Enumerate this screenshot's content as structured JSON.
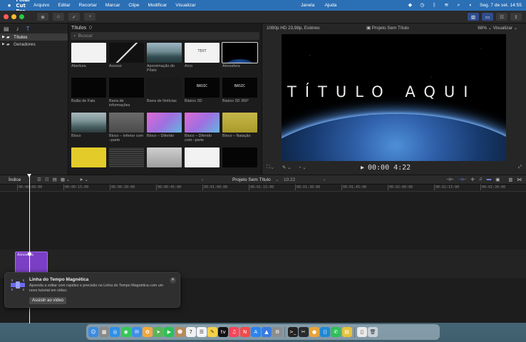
{
  "menubar": {
    "app_name": "Final Cut Pro",
    "items": [
      "Arquivo",
      "Editar",
      "Recortar",
      "Marcar",
      "Clipe",
      "Modificar",
      "Visualizar"
    ],
    "center_items": [
      "Janela",
      "Ajuda"
    ],
    "clock": "Seg. 7 de set.  14:55"
  },
  "sidebar": {
    "items": [
      {
        "label": "Títulos",
        "selected": true
      },
      {
        "label": "Geradores",
        "selected": false
      }
    ]
  },
  "browser": {
    "heading": "Títulos",
    "count": "0",
    "search_placeholder": "Buscar",
    "tiles": [
      {
        "label": "Abertura",
        "style": "t-white"
      },
      {
        "label": "Acesso",
        "style": "t-split"
      },
      {
        "label": "Aproximação do Pôsto",
        "style": "t-mount"
      },
      {
        "label": "Arco",
        "style": "t-white",
        "thumb_text": "TEXT"
      },
      {
        "label": "Atmosfera",
        "style": "t-earth",
        "selected": true
      },
      {
        "label": "Balão de Fala",
        "style": "t-black"
      },
      {
        "label": "Barra de informações",
        "style": "t-black"
      },
      {
        "label": "Barra de Notícias",
        "style": "t-dark"
      },
      {
        "label": "Básico 3D",
        "style": "t-black",
        "thumb_text": "BASIC"
      },
      {
        "label": "Básico 3D 360°",
        "style": "t-black",
        "thumb_text": "BASIC"
      },
      {
        "label": "Bloco",
        "style": "t-mount2"
      },
      {
        "label": "Bloco – Inferior com –parte",
        "style": "t-grey"
      },
      {
        "label": "Bloco – Diferido",
        "style": "t-pink"
      },
      {
        "label": "Bloco – Diferido com –parte",
        "style": "t-pink"
      },
      {
        "label": "Bloco – Natação",
        "style": "t-yellow"
      },
      {
        "label": "",
        "style": "t-yellow2"
      },
      {
        "label": "",
        "style": "t-text"
      },
      {
        "label": "",
        "style": "t-paper"
      },
      {
        "label": "",
        "style": "t-white"
      },
      {
        "label": "",
        "style": "t-black"
      }
    ]
  },
  "viewer": {
    "format": "1080p HD 23,98p, Estéreo",
    "project": "Projeto Sem Título",
    "zoom": "68%",
    "view_menu": "Visualizar",
    "title_text": "TÍTULO AQUI",
    "timecode": "00:00 4:22"
  },
  "timeline": {
    "index_label": "Índice",
    "project": "Projeto Sem Título",
    "duration": "10:22",
    "ruler": [
      "00:00:00:00",
      "00:00:15:00",
      "00:00:30:00",
      "00:00:45:00",
      "00:01:00:00",
      "00:01:15:00",
      "00:01:30:00",
      "00:01:45:00",
      "00:02:00:00",
      "00:02:15:00",
      "00:02:30:00"
    ],
    "clip_label": "Atmosfera"
  },
  "notification": {
    "title": "Linha do Tempo Magnética",
    "body": "Aprenda a editar com rapidez e precisão na Linha do Tempo Magnética com um novo tutorial em vídeo.",
    "button": "Assistir ao vídeo"
  },
  "colors": {
    "menubar": "#2b6fb5",
    "accent": "#6f86ff",
    "clip": "#7a3fc4"
  },
  "dock_apps": [
    {
      "name": "finder-icon",
      "color": "#3b8be0",
      "glyph": "☺"
    },
    {
      "name": "launchpad-icon",
      "color": "#8a8a8a",
      "glyph": "▦"
    },
    {
      "name": "safari-icon",
      "color": "#2f8fe6",
      "glyph": "◎"
    },
    {
      "name": "messages-icon",
      "color": "#34c759",
      "glyph": "◉"
    },
    {
      "name": "mail-icon",
      "color": "#3f8fe8",
      "glyph": "✉"
    },
    {
      "name": "photos-icon",
      "color": "#f2a93b",
      "glyph": "✿"
    },
    {
      "name": "maps-icon",
      "color": "#5ab45a",
      "glyph": "➤"
    },
    {
      "name": "facetime-icon",
      "color": "#2fbf55",
      "glyph": "▶"
    },
    {
      "name": "contacts-icon",
      "color": "#b38b5d",
      "glyph": "☻"
    },
    {
      "name": "calendar-icon",
      "color": "#f0f0f0",
      "glyph": "7"
    },
    {
      "name": "reminders-icon",
      "color": "#f4f4f4",
      "glyph": "☰"
    },
    {
      "name": "notes-icon",
      "color": "#f5d04a",
      "glyph": "✎"
    },
    {
      "name": "tv-icon",
      "color": "#111111",
      "glyph": "tv"
    },
    {
      "name": "music-icon",
      "color": "#f6455a",
      "glyph": "♫"
    },
    {
      "name": "news-icon",
      "color": "#f14a4a",
      "glyph": "N"
    },
    {
      "name": "appstore-icon",
      "color": "#2a84f0",
      "glyph": "A"
    },
    {
      "name": "keynote-icon",
      "color": "#3a7be0",
      "glyph": "▲"
    },
    {
      "name": "settings-icon",
      "color": "#8d8d8d",
      "glyph": "⚙"
    },
    {
      "name": "terminal-icon",
      "color": "#222222",
      "glyph": ">_"
    },
    {
      "name": "finalcut-icon",
      "color": "#2a2a2a",
      "glyph": "✂"
    },
    {
      "name": "chrome-icon",
      "color": "#e8a33a",
      "glyph": "●"
    },
    {
      "name": "vscode-icon",
      "color": "#1e88d6",
      "glyph": "⟨⟩"
    },
    {
      "name": "whatsapp-icon",
      "color": "#2fc05a",
      "glyph": "✆"
    },
    {
      "name": "claquete-icon",
      "color": "#e6c23a",
      "glyph": "▤"
    },
    {
      "name": "documents-icon",
      "color": "#eaeaea",
      "glyph": "▯"
    },
    {
      "name": "trash-icon",
      "color": "#c9d2d8",
      "glyph": "🗑"
    }
  ]
}
